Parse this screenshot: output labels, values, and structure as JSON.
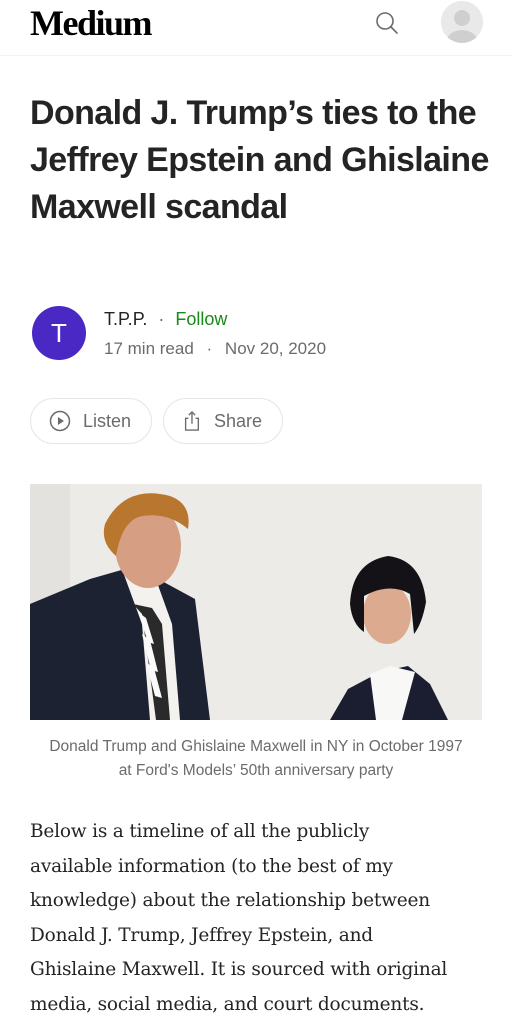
{
  "header": {
    "logo": "Medium",
    "icons": [
      "search-icon",
      "user-avatar"
    ]
  },
  "article": {
    "title": "Donald J. Trump’s ties to the Jeffrey Epstein and Ghislaine Maxwell scandal",
    "author": {
      "initial": "T",
      "name": "T.P.P.",
      "separator": "·",
      "follow_label": "Follow"
    },
    "meta": {
      "read_time": "17 min read",
      "separator": "·",
      "date": "Nov 20, 2020"
    },
    "actions": {
      "listen_label": "Listen",
      "share_label": "Share"
    },
    "image": {
      "caption_line1": "Donald Trump and Ghislaine Maxwell in NY in October 1997",
      "caption_line2": "at Ford's Models’ 50th anniversary party"
    },
    "body": [
      "Below is a timeline of all the publicly",
      "available information (to the best of my",
      "knowledge) about the relationship between",
      "Donald J. Trump, Jeffrey Epstein, and",
      "Ghislaine Maxwell. It is sourced with original",
      "media, social media, and court documents."
    ]
  },
  "colors": {
    "text": "#242424",
    "muted": "#6b6b6b",
    "follow": "#1a8917",
    "author_avatar": "#4a28c4"
  }
}
